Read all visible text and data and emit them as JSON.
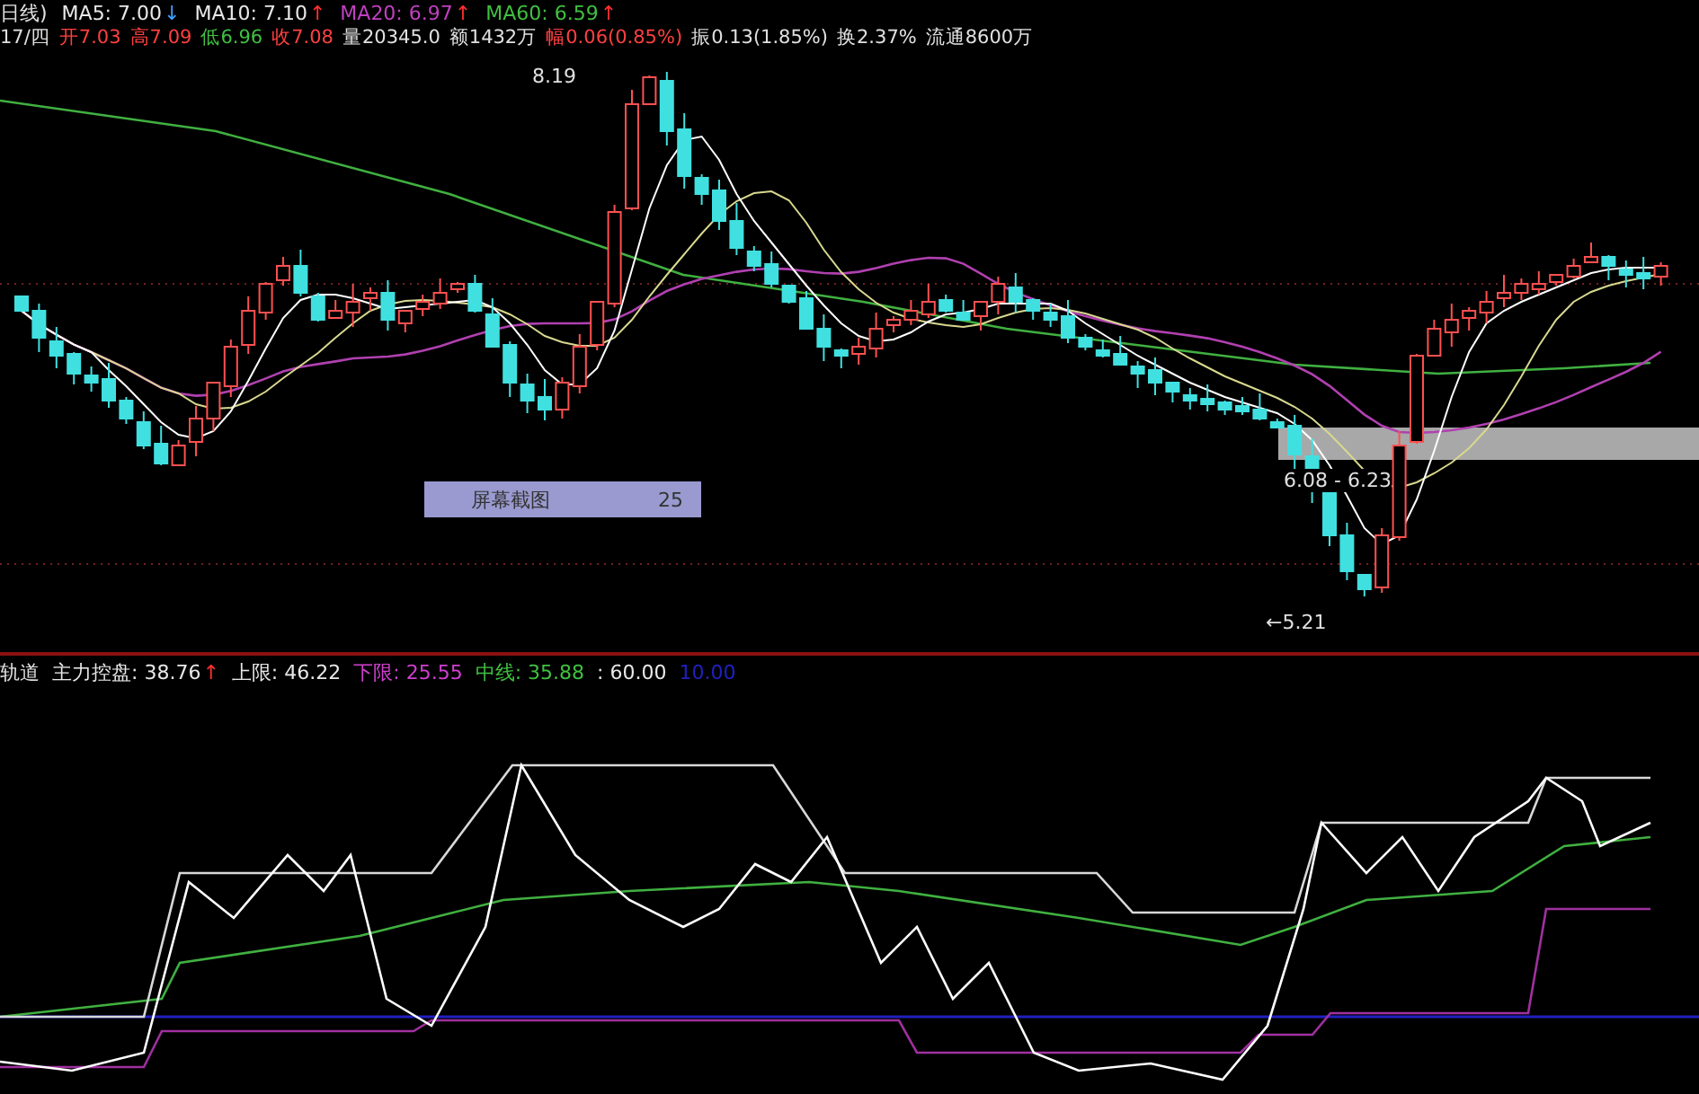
{
  "header": {
    "period": "日线)",
    "mas": [
      {
        "label": "MA5: 7.00",
        "color": "#e8e8e8",
        "arrow": {
          "text": "↓",
          "color": "#40a0ff"
        }
      },
      {
        "label": "MA10: 7.10",
        "color": "#e8e8e8",
        "arrow": {
          "text": "↑",
          "color": "#ff3030"
        }
      },
      {
        "label": "MA20: 6.97",
        "color": "#c040c0",
        "arrow": {
          "text": "↑",
          "color": "#ff3030"
        }
      },
      {
        "label": "MA60: 6.59",
        "color": "#40c040",
        "arrow": {
          "text": "↑",
          "color": "#ff3030"
        }
      }
    ]
  },
  "quote": {
    "date": "17/四",
    "fields": [
      {
        "text": "开7.03",
        "color": "#ff4040"
      },
      {
        "text": "高7.09",
        "color": "#ff4040"
      },
      {
        "text": "低6.96",
        "color": "#40c040"
      },
      {
        "text": "收7.08",
        "color": "#ff4040"
      },
      {
        "text": "量20345.0",
        "color": "#e0e0e0"
      },
      {
        "text": "额1432万",
        "color": "#e0e0e0"
      },
      {
        "text": "幅0.06(0.85%)",
        "color": "#ff4040"
      },
      {
        "text": "振0.13(1.85%)",
        "color": "#e0e0e0"
      },
      {
        "text": "换2.37%",
        "color": "#e0e0e0"
      },
      {
        "text": "流通8600万",
        "color": "#e0e0e0"
      }
    ]
  },
  "price_chart": {
    "high_label": "8.19",
    "range_label": "6.08 - 6.23",
    "low_label": "←5.21",
    "tooltip": {
      "title": "屏幕截图",
      "value": "25"
    }
  },
  "indicator": {
    "name": "轨道",
    "items": [
      {
        "text": "主力控盘: 38.76",
        "color": "#e8e8e8",
        "arrow": {
          "text": "↑",
          "color": "#ff3030"
        }
      },
      {
        "text": "上限: 46.22",
        "color": "#e8e8e8"
      },
      {
        "text": "下限: 25.55",
        "color": "#d040d0"
      },
      {
        "text": "中线: 35.88",
        "color": "#40c040"
      },
      {
        "text": ": 60.00",
        "color": "#e8e8e8"
      },
      {
        "text": "10.00",
        "color": "#2020c0"
      }
    ]
  }
}
